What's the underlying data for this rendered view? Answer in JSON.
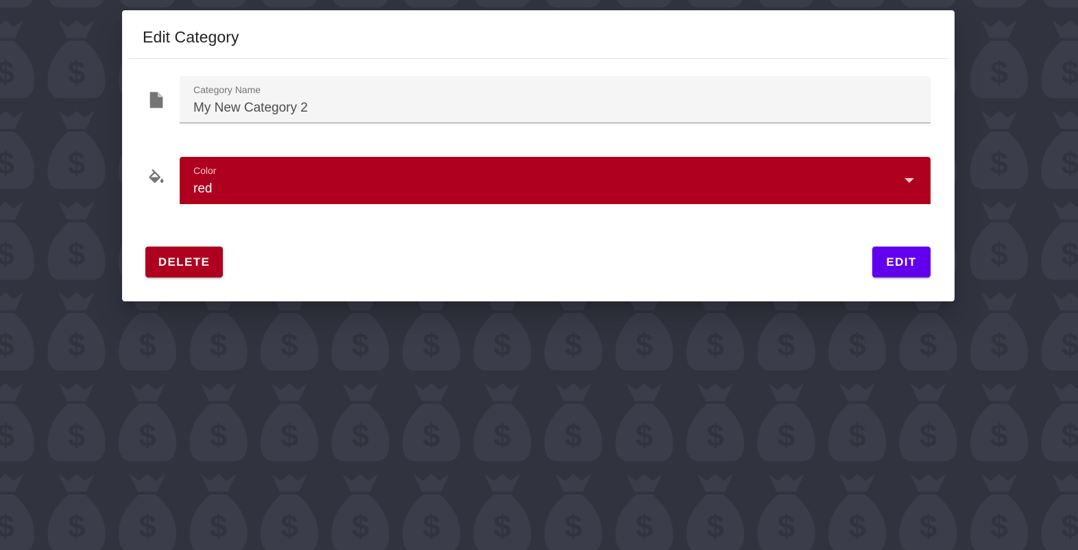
{
  "dialog": {
    "title": "Edit Category",
    "name_field": {
      "label": "Category Name",
      "value": "My New Category 2",
      "icon": "file-icon"
    },
    "color_field": {
      "label": "Color",
      "value": "red",
      "icon": "paint-bucket-icon"
    },
    "delete_label": "DELETE",
    "edit_label": "EDIT"
  },
  "colors": {
    "background": "#31333f",
    "background_pattern": "#3b3d4b",
    "selected_color": "#b0001f",
    "delete_button": "#b0001f",
    "edit_button": "#6200ee"
  }
}
